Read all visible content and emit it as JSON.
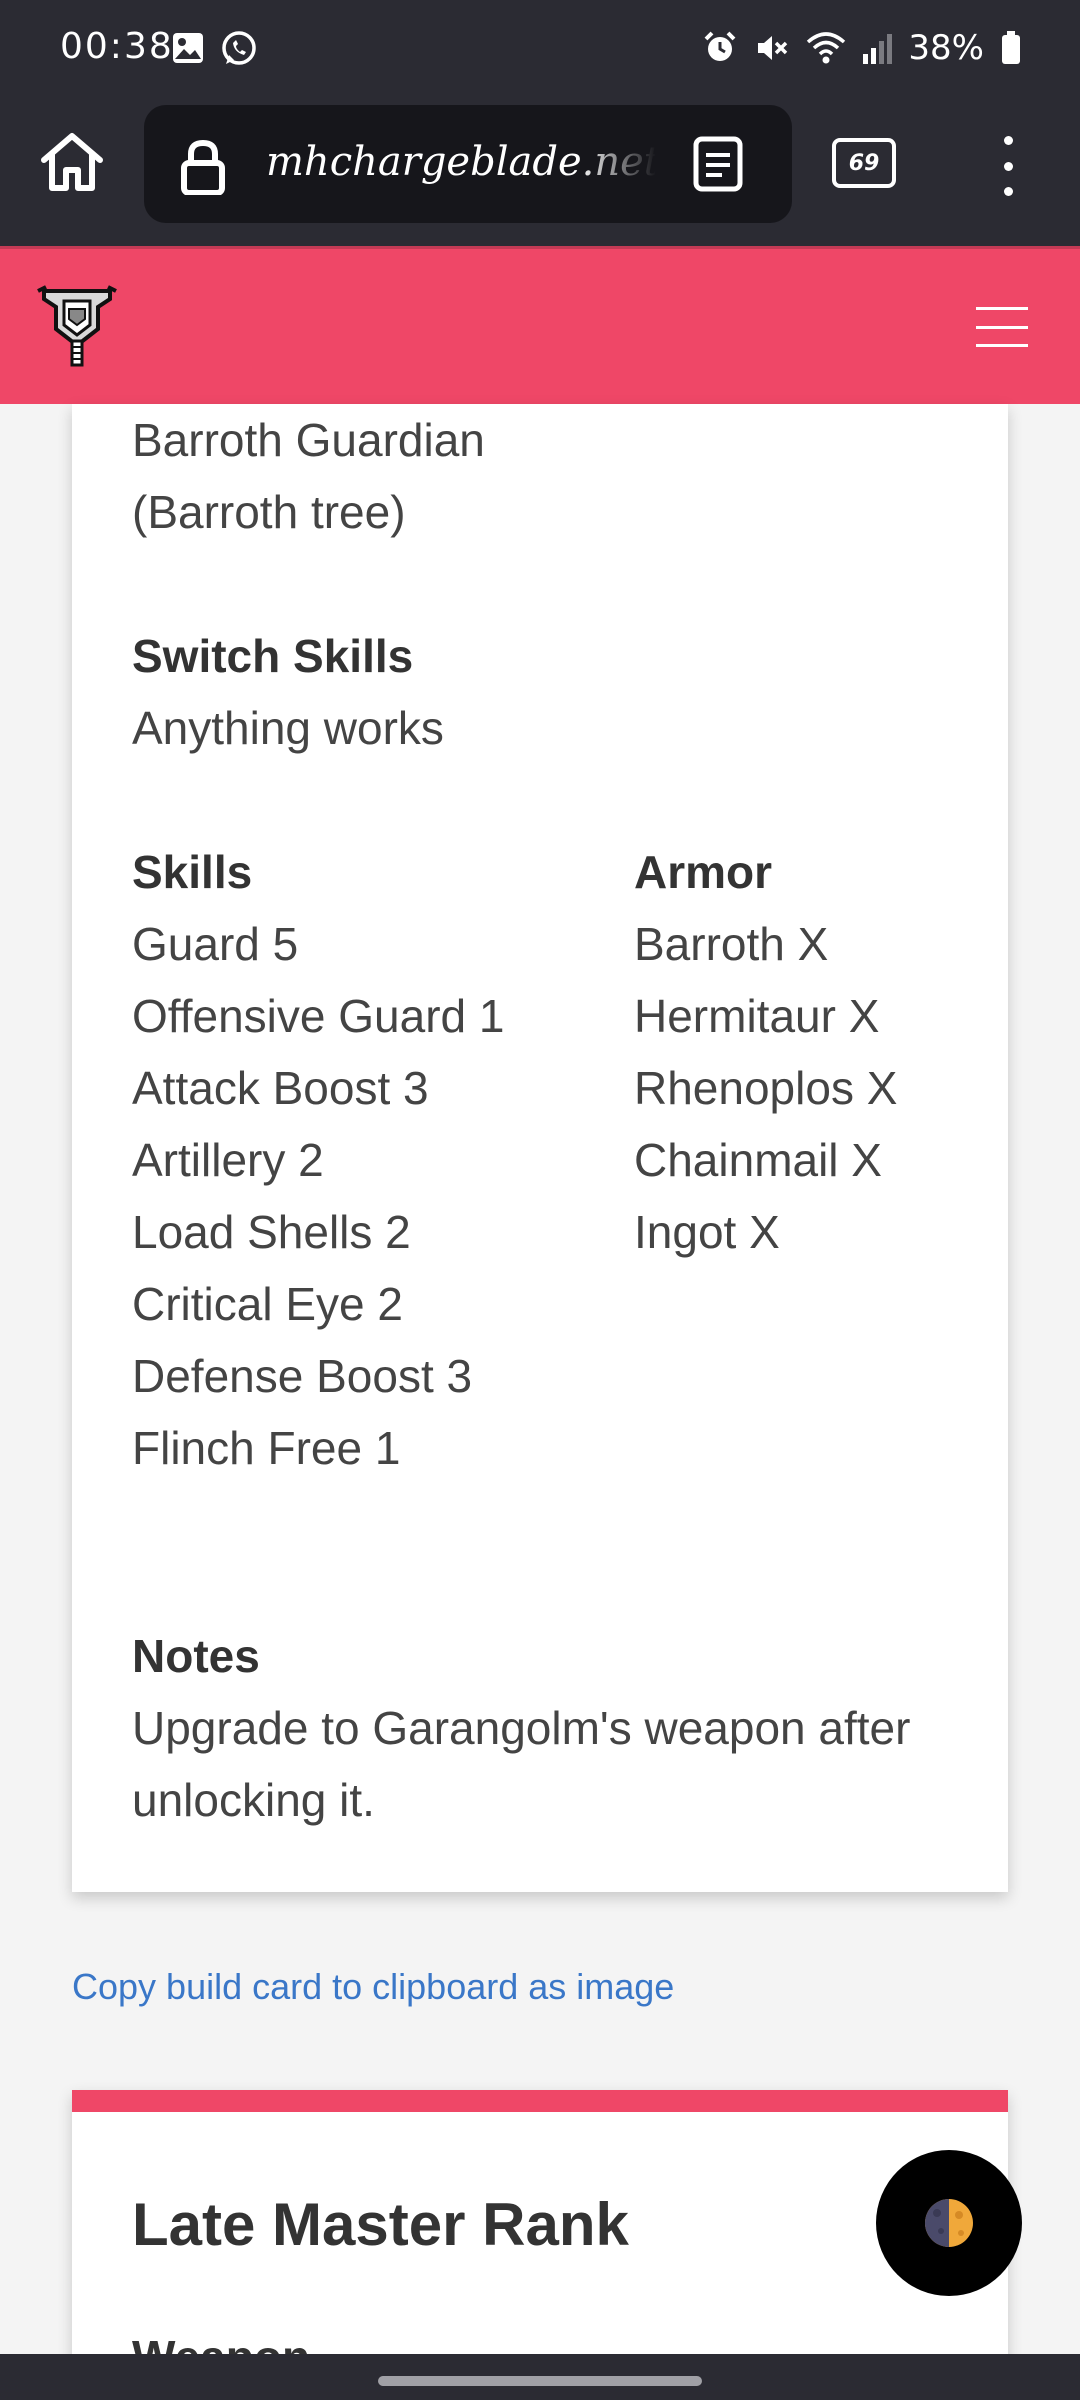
{
  "status_bar": {
    "time": "00:38",
    "battery": "38%",
    "left_icons": [
      "gallery-icon",
      "whatsapp-icon"
    ],
    "right_icons": [
      "alarm-icon",
      "mute-icon",
      "wifi-icon",
      "signal-icon",
      "battery-icon"
    ]
  },
  "browser": {
    "url": "mhchargeblade.net",
    "tab_count": "69"
  },
  "build_card": {
    "weapon_lines": [
      "Barroth Guardian",
      "(Barroth tree)"
    ],
    "switch_skills_heading": "Switch Skills",
    "switch_skills_value": "Anything works",
    "skills_heading": "Skills",
    "skills": [
      "Guard 5",
      "Offensive Guard 1",
      "Attack Boost 3",
      "Artillery 2",
      "Load Shells 2",
      "Critical Eye 2",
      "Defense Boost 3",
      "Flinch Free 1"
    ],
    "armor_heading": "Armor",
    "armor": [
      "Barroth X",
      "Hermitaur X",
      "Rhenoplos X",
      "Chainmail X",
      "Ingot X"
    ],
    "notes_heading": "Notes",
    "notes_lines": [
      "Upgrade to Garangolm's weapon after",
      "unlocking it."
    ]
  },
  "copy_link": "Copy build card to clipboard as image",
  "next_card": {
    "title": "Late Master Rank",
    "subheading": "Weapon"
  },
  "colors": {
    "header_bg": "#ef4767",
    "browser_bg": "#2b2b33",
    "link": "#3a77c8"
  }
}
